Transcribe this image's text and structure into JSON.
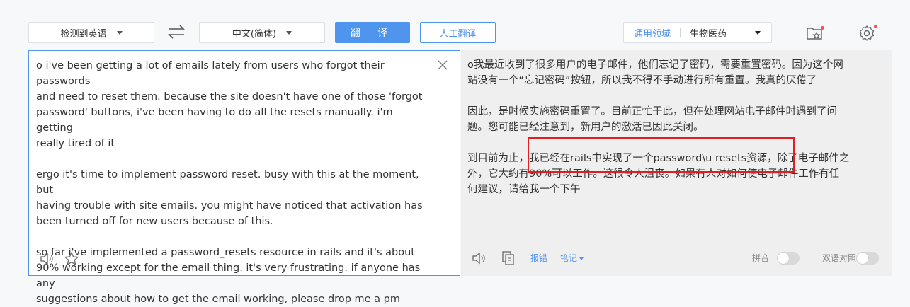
{
  "toolbar": {
    "source_lang": "检测到英语",
    "target_lang": "中文(简体)",
    "translate_label": "翻 译",
    "human_translate_label": "人工翻译",
    "domain_label": "通用领域",
    "domain_value": "生物医药"
  },
  "source": {
    "text": "o i've been getting a lot of emails lately from users who forgot their passwords\nand need to reset them. because the site doesn't have one of those 'forgot\npassword' buttons, i've been having to do all the resets manually. i'm getting\nreally tired of it\n\nergo it's time to implement password reset. busy with this at the moment, but\nhaving trouble with site emails. you might have noticed that activation has\nbeen turned off for new users because of this.\n\nso far i've implemented a password_resets resource in rails and it's about\n90% working except for the email thing. it's very frustrating. if anyone has any\nsuggestions about how to get the email working, please drop me a pm"
  },
  "target": {
    "text": "o我最近收到了很多用户的电子邮件，他们忘记了密码，需要重置密码。因为这个网\n站没有一个“忘记密码”按钮，所以我不得不手动进行所有重置。我真的厌倦了\n\n因此，是时候实施密码重置了。目前正忙于此，但在处理网站电子邮件时遇到了问\n题。您可能已经注意到，新用户的激活已因此关闭。\n\n到目前为止，我已经在rails中实现了一个password\\u resets资源，除了电子邮件之\n外，它大约有90%可以工作。这很令人沮丧。如果有人对如何使电子邮件工作有任\n何建议，请给我一个下午",
    "report_label": "报错",
    "notes_label": "笔记",
    "pinyin_label": "拼音",
    "bilingual_label": "双语对照"
  },
  "colors": {
    "accent": "#4f95ee",
    "highlight_box": "#e02020",
    "notify_dot": "#f25448"
  },
  "icons": [
    "swap-icon",
    "favorites-icon",
    "settings-icon",
    "close-icon",
    "speaker-icon",
    "star-icon",
    "copy-icon"
  ]
}
